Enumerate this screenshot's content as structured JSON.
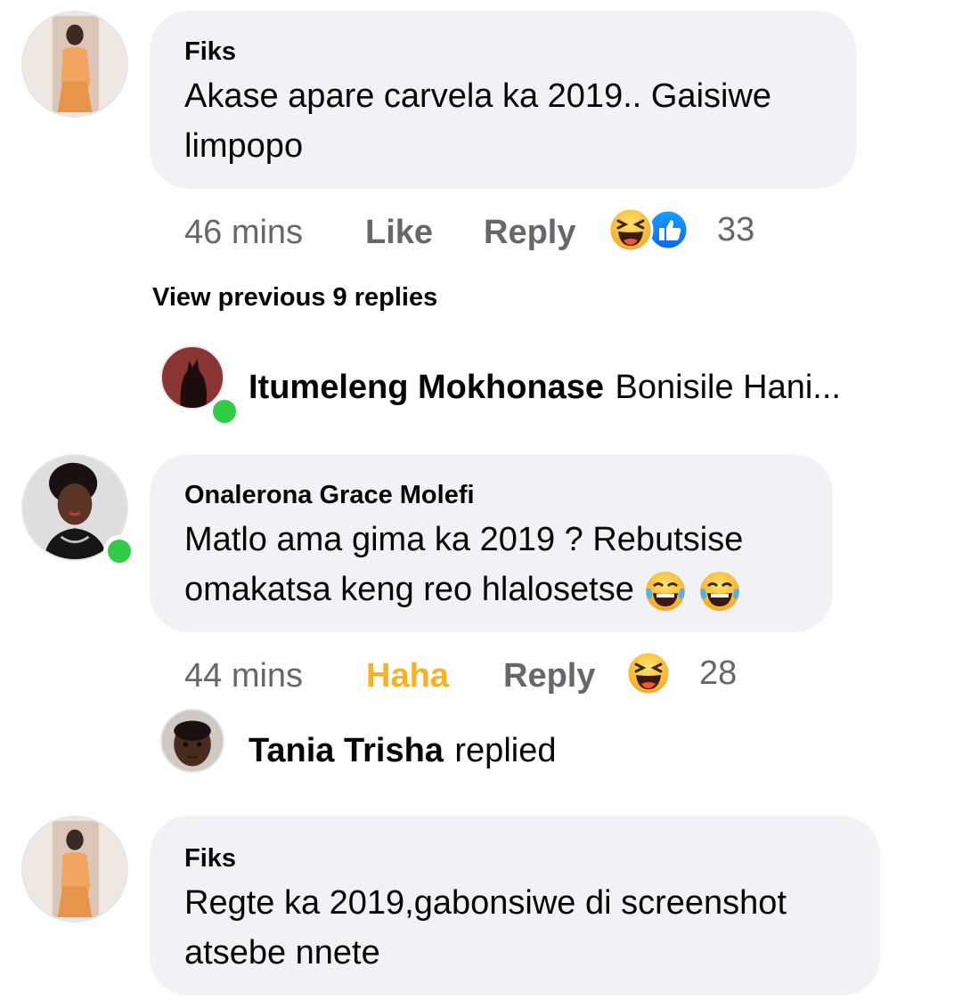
{
  "comments": [
    {
      "author": "Fiks",
      "text_line1": "Akase apare carvela ka 2019.. Gaisiwe",
      "text_line2": "limpopo",
      "time": "46 mins",
      "like_label": "Like",
      "reply_label": "Reply",
      "reaction_count": "33",
      "reactions": [
        "haha-icon",
        "like-icon"
      ]
    },
    {
      "author": "Onalerona Grace Molefi",
      "text_line1": "Matlo ama gima ka 2019 ? Rebutsise",
      "text_line2": "omakatsa keng reo hlalosetse",
      "inline_emoji": [
        "joy-emoji",
        "joy-emoji"
      ],
      "time": "44 mins",
      "like_label": "Haha",
      "reply_label": "Reply",
      "reaction_count": "28",
      "reactions": [
        "haha-icon"
      ],
      "online": true
    },
    {
      "author": "Fiks",
      "text_line1": "Regte ka 2019,gabonsiwe di screenshot",
      "text_line2": "atsebe nnete"
    }
  ],
  "view_previous": "View previous 9 replies",
  "reply_previews": [
    {
      "name": "Itumeleng Mokhonase",
      "text": "Bonisile Hani...",
      "online": true
    },
    {
      "name": "Tania Trisha",
      "text": "replied"
    }
  ],
  "colors": {
    "bubble": "#f0f2f5",
    "meta": "#65676b",
    "haha": "#f7b125",
    "online": "#31cc46",
    "like_blue": "#1877f2"
  }
}
